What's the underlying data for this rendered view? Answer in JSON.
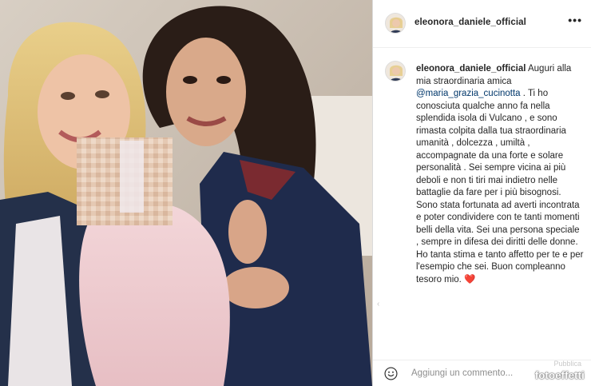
{
  "post": {
    "username": "eleonora_daniele_official",
    "more_icon": "•••",
    "caption_intro": "Auguri alla mia straordinaria amica",
    "mention": "@maria_grazia_cucinotta",
    "caption_body": ". Ti ho conosciuta qualche anno fa nella splendida isola di Vulcano , e sono rimasta colpita dalla tua straordinaria umanità , dolcezza , umiltà , accompagnate da una forte e solare personalità . Sei sempre vicina ai più deboli e non ti tiri mai indietro nelle battaglie da fare per i più bisognosi. Sono stata fortunata ad averti incontrata e poter condividere con te tanti momenti belli della vita. Sei una persona speciale , sempre in difesa dei diritti delle donne. Ho tanta stima e tanto affetto per te e per l'esempio che sei. Buon compleanno tesoro mio.",
    "caption_emoji": "❤️",
    "scroll_mark": "‹"
  },
  "comment": {
    "placeholder": "Aggiungi un commento...",
    "publish_label": "Pubblica"
  },
  "watermark": "fotoeffetti",
  "colors": {
    "text": "#262626",
    "mention": "#00376b",
    "placeholder": "#8e8e8e",
    "heart": "#ed4956",
    "border": "#dbdbdb"
  },
  "icons": {
    "more": "more-options-icon",
    "emoji": "emoji-icon"
  }
}
